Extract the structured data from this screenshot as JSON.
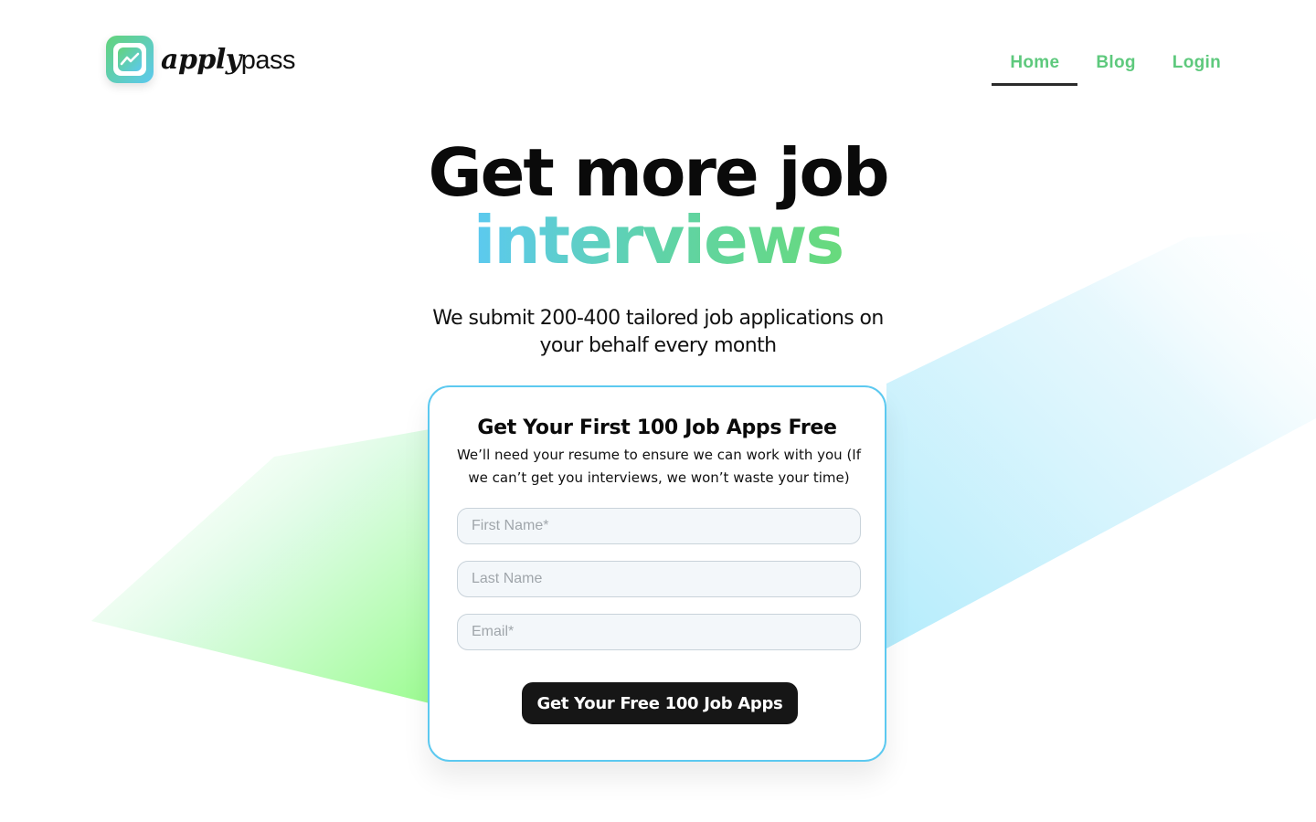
{
  "brand": {
    "logo_text_script": "apply",
    "logo_text_plain": "pass",
    "logo_icon": "chart-trend-icon",
    "accent_green": "#5ec97d",
    "accent_blue": "#5cc9f0"
  },
  "nav": {
    "items": [
      {
        "label": "Home",
        "active": true
      },
      {
        "label": "Blog",
        "active": false
      },
      {
        "label": "Login",
        "active": false
      }
    ]
  },
  "hero": {
    "title_line1": "Get more job",
    "title_line2": "interviews",
    "subtitle": "We submit 200-400 tailored job applications on your behalf every month"
  },
  "form": {
    "title": "Get Your First 100 Job Apps Free",
    "description": "We’ll need your resume to ensure we can work with you (If we can’t get you interviews, we won’t waste your time)",
    "first_name_placeholder": "First Name*",
    "last_name_placeholder": "Last Name",
    "email_placeholder": "Email*",
    "submit_label": "Get Your Free 100 Job Apps"
  }
}
